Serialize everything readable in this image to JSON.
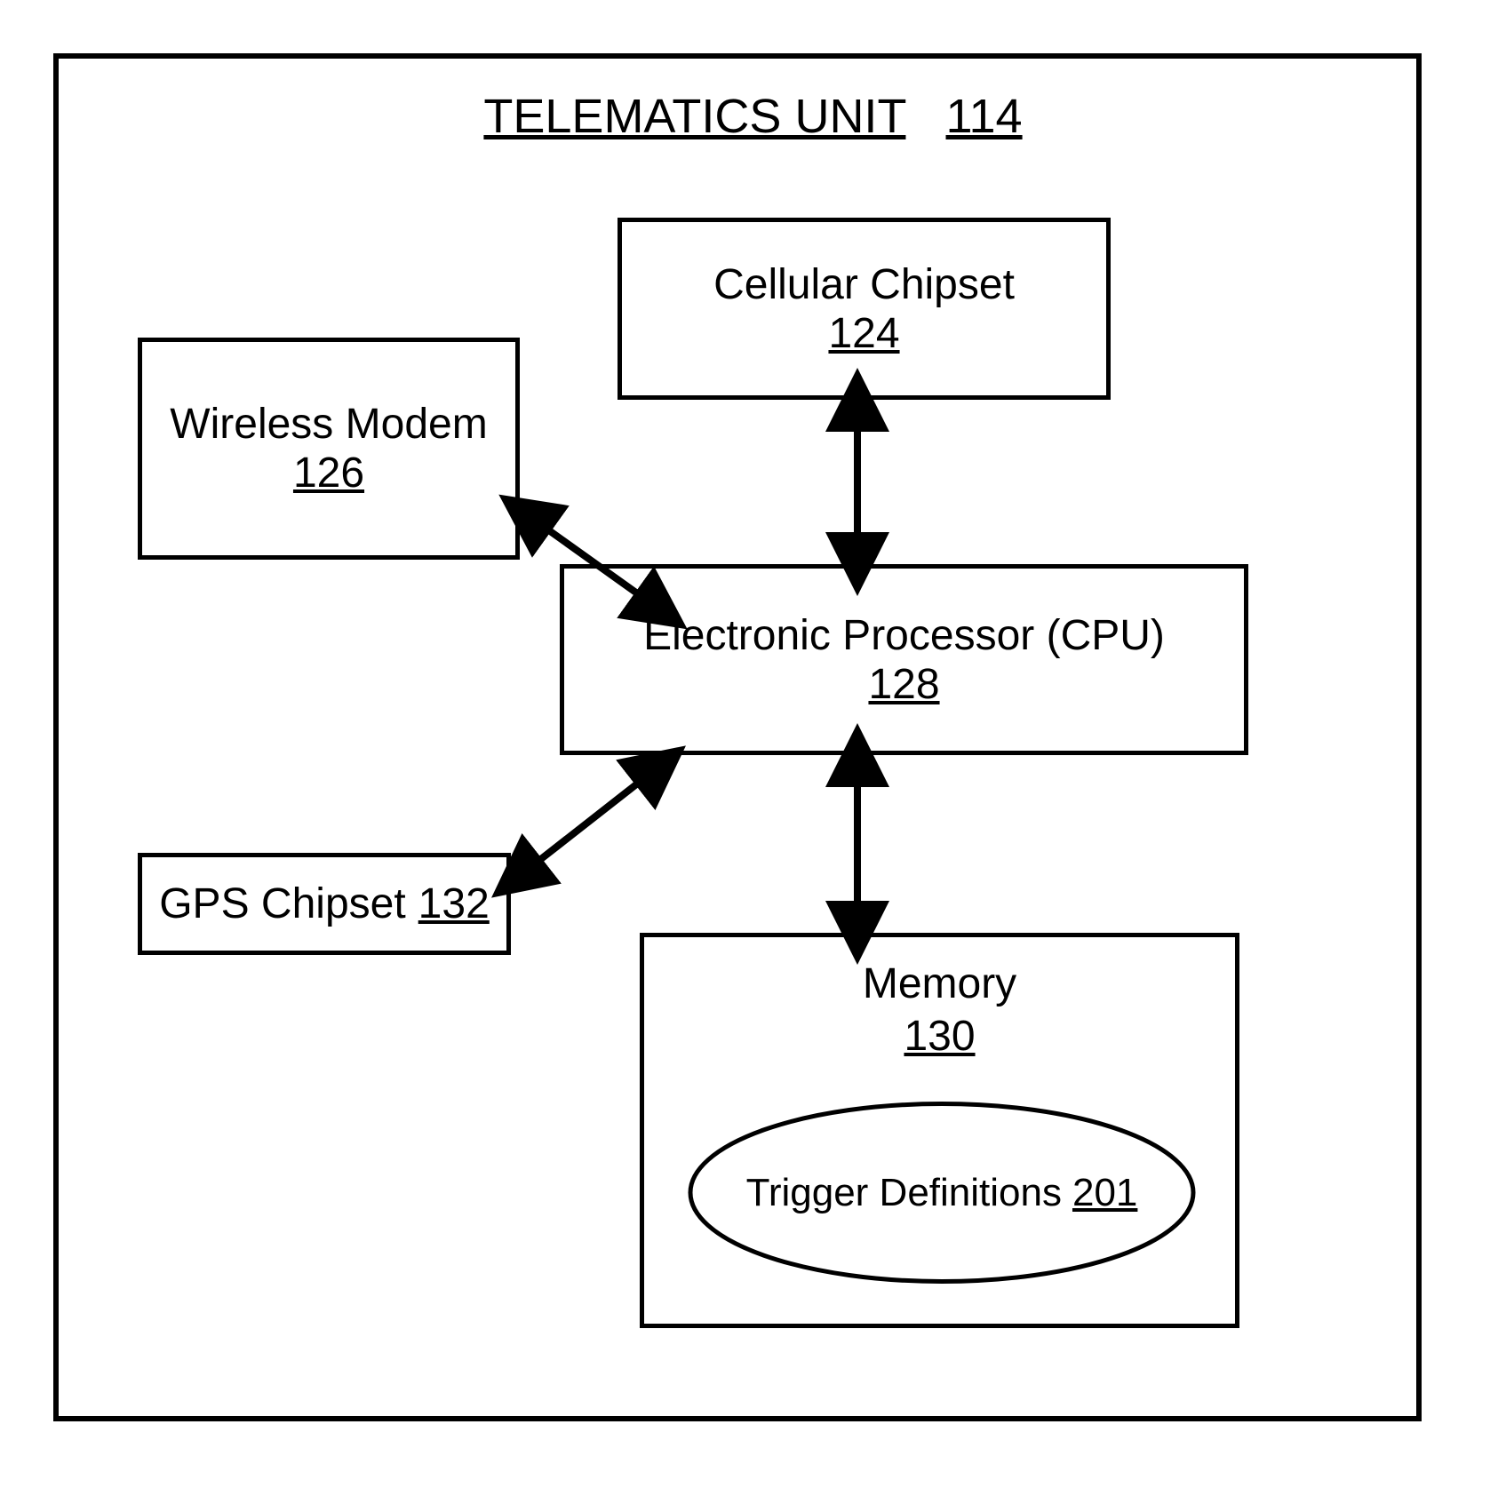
{
  "title": {
    "label": "TELEMATICS UNIT",
    "num": "114"
  },
  "blocks": {
    "wireless": {
      "label": "Wireless Modem",
      "num": "126"
    },
    "cellular": {
      "label": "Cellular Chipset",
      "num": "124"
    },
    "cpu": {
      "label": "Electronic Processor (CPU)",
      "num": "128"
    },
    "gps": {
      "label": "GPS Chipset",
      "num": "132"
    },
    "memory": {
      "label": "Memory",
      "num": "130"
    },
    "trigger": {
      "label": "Trigger Definitions",
      "num": "201"
    }
  }
}
